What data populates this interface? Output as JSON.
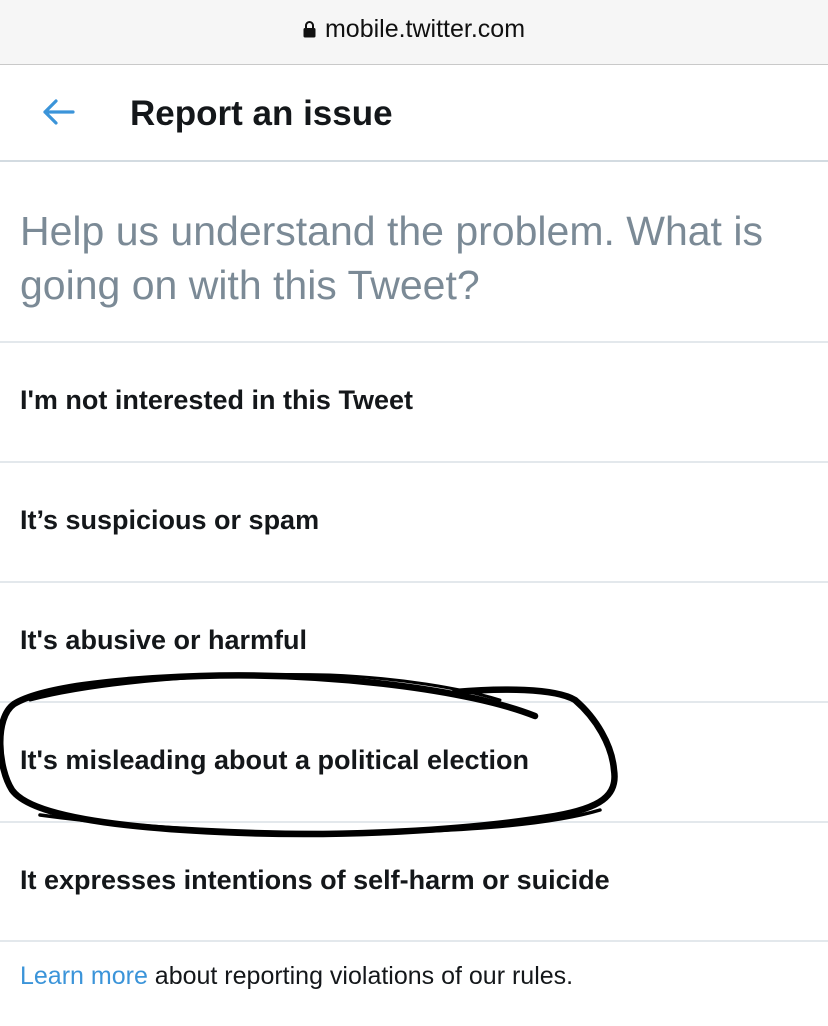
{
  "browser": {
    "url": "mobile.twitter.com",
    "lock_icon": "lock-icon"
  },
  "header": {
    "back_icon": "back-arrow-icon",
    "title": "Report an issue",
    "accent_color": "#3b94d9"
  },
  "prompt": {
    "text": "Help us understand the problem. What is going on with this Tweet?"
  },
  "options": [
    {
      "label": "I'm not interested in this Tweet"
    },
    {
      "label": "It’s suspicious or spam"
    },
    {
      "label": "It's abusive or harmful"
    },
    {
      "label": "It's misleading about a political election",
      "circled": true
    },
    {
      "label": "It expresses intentions of self-harm or suicide"
    }
  ],
  "footer": {
    "link_text": "Learn more",
    "rest_text": " about reporting violations of our rules.",
    "link_color": "#3b94d9"
  },
  "annotation": {
    "type": "hand-drawn-circle",
    "color": "#000000"
  }
}
